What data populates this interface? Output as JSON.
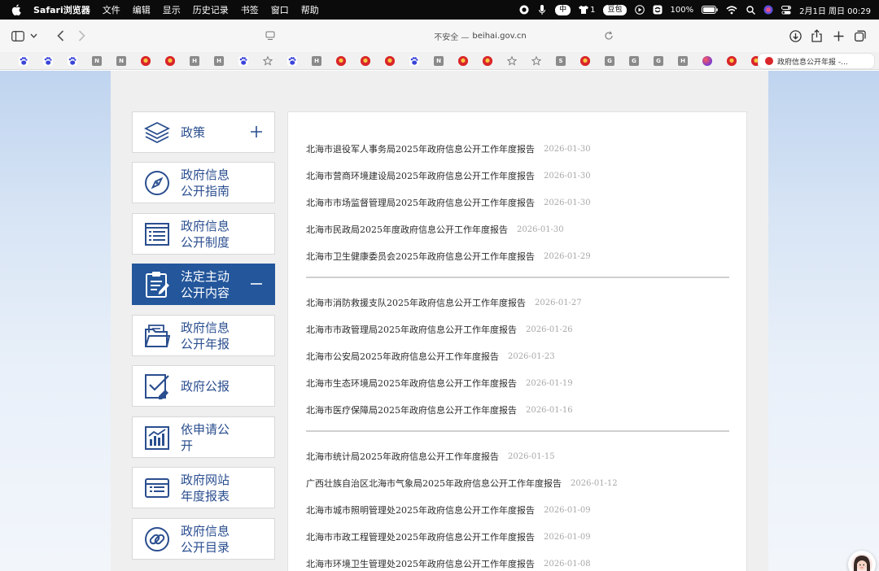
{
  "menubar": {
    "app_name": "Safari浏览器",
    "items": [
      "文件",
      "编辑",
      "显示",
      "历史记录",
      "书签",
      "窗口",
      "帮助"
    ],
    "status": {
      "input_method": "中",
      "notification_count": "1",
      "douban_label": "豆包",
      "battery": "100%",
      "datetime": "2月1日 周日  00:29"
    }
  },
  "toolbar": {
    "address_insecure": "不安全 —",
    "address_domain": "beihai.gov.cn"
  },
  "favorites": {
    "items": [
      {
        "type": "paw",
        "letter": ""
      },
      {
        "type": "paw",
        "letter": ""
      },
      {
        "type": "paw",
        "letter": ""
      },
      {
        "type": "letter",
        "letter": "N"
      },
      {
        "type": "letter",
        "letter": "N"
      },
      {
        "type": "emblem",
        "letter": ""
      },
      {
        "type": "emblem",
        "letter": ""
      },
      {
        "type": "letter",
        "letter": "H"
      },
      {
        "type": "letter",
        "letter": "H"
      },
      {
        "type": "paw",
        "letter": ""
      },
      {
        "type": "star",
        "letter": ""
      },
      {
        "type": "paw",
        "letter": ""
      },
      {
        "type": "letter",
        "letter": "H"
      },
      {
        "type": "emblem",
        "letter": ""
      },
      {
        "type": "emblem",
        "letter": ""
      },
      {
        "type": "emblem",
        "letter": ""
      },
      {
        "type": "paw",
        "letter": ""
      },
      {
        "type": "letter",
        "letter": "N"
      },
      {
        "type": "emblem",
        "letter": ""
      },
      {
        "type": "emblem",
        "letter": ""
      },
      {
        "type": "star",
        "letter": ""
      },
      {
        "type": "star",
        "letter": ""
      },
      {
        "type": "letter",
        "letter": "S"
      },
      {
        "type": "emblem",
        "letter": ""
      },
      {
        "type": "letter",
        "letter": "G"
      },
      {
        "type": "letter",
        "letter": "G"
      },
      {
        "type": "letter",
        "letter": "G"
      },
      {
        "type": "letter",
        "letter": "H"
      },
      {
        "type": "multi",
        "letter": ""
      },
      {
        "type": "emblem",
        "letter": ""
      },
      {
        "type": "emblem",
        "letter": ""
      }
    ],
    "active_tab_title": "政府信息公开年报 -..."
  },
  "sidebar": {
    "items": [
      {
        "label_line1": "政策",
        "label_line2": "",
        "icon": "layers-icon",
        "toggle": "plus",
        "active": false
      },
      {
        "label_line1": "政府信息",
        "label_line2": "公开指南",
        "icon": "compass-icon",
        "toggle": "",
        "active": false
      },
      {
        "label_line1": "政府信息",
        "label_line2": "公开制度",
        "icon": "list-doc-icon",
        "toggle": "",
        "active": false
      },
      {
        "label_line1": "法定主动",
        "label_line2": "公开内容",
        "icon": "clipboard-edit-icon",
        "toggle": "minus",
        "active": true
      },
      {
        "label_line1": "政府信息",
        "label_line2": "公开年报",
        "icon": "folder-icon",
        "toggle": "",
        "active": false
      },
      {
        "label_line1": "政府公报",
        "label_line2": "",
        "icon": "check-doc-icon",
        "toggle": "",
        "active": false
      },
      {
        "label_line1": "依申请公",
        "label_line2": "开",
        "icon": "chart-icon",
        "toggle": "",
        "active": false
      },
      {
        "label_line1": "政府网站",
        "label_line2": "年度报表",
        "icon": "report-icon",
        "toggle": "",
        "active": false
      },
      {
        "label_line1": "政府信息",
        "label_line2": "公开目录",
        "icon": "link-icon",
        "toggle": "",
        "active": false
      }
    ]
  },
  "reports": {
    "groups": [
      [
        {
          "title": "北海市退役军人事务局2025年政府信息公开工作年度报告",
          "date": "2026-01-30"
        },
        {
          "title": "北海市营商环境建设局2025年政府信息公开工作年度报告",
          "date": "2026-01-30"
        },
        {
          "title": "北海市市场监督管理局2025年政府信息公开工作年度报告",
          "date": "2026-01-30"
        },
        {
          "title": "北海市民政局2025年度政府信息公开工作年度报告",
          "date": "2026-01-30"
        },
        {
          "title": "北海市卫生健康委员会2025年政府信息公开工作年度报告",
          "date": "2026-01-29"
        }
      ],
      [
        {
          "title": "北海市消防救援支队2025年政府信息公开工作年度报告",
          "date": "2026-01-27"
        },
        {
          "title": "北海市市政管理局2025年政府信息公开工作年度报告",
          "date": "2026-01-26"
        },
        {
          "title": "北海市公安局2025年政府信息公开工作年度报告",
          "date": "2026-01-23"
        },
        {
          "title": "北海市生态环境局2025年政府信息公开工作年度报告",
          "date": "2026-01-19"
        },
        {
          "title": "北海市医疗保障局2025年政府信息公开工作年度报告",
          "date": "2026-01-16"
        }
      ],
      [
        {
          "title": "北海市统计局2025年政府信息公开工作年度报告",
          "date": "2026-01-15"
        },
        {
          "title": "广西壮族自治区北海市气象局2025年政府信息公开工作年度报告",
          "date": "2026-01-12"
        },
        {
          "title": "北海市城市照明管理处2025年政府信息公开工作年度报告",
          "date": "2026-01-09"
        },
        {
          "title": "北海市市政工程管理处2025年政府信息公开工作年度报告",
          "date": "2026-01-09"
        },
        {
          "title": "北海市环境卫生管理处2025年政府信息公开工作年度报告",
          "date": "2026-01-08"
        }
      ]
    ]
  },
  "colors": {
    "active_nav": "#23569b",
    "nav_text": "#2a4e8f",
    "date_text": "#a8a8a8"
  }
}
